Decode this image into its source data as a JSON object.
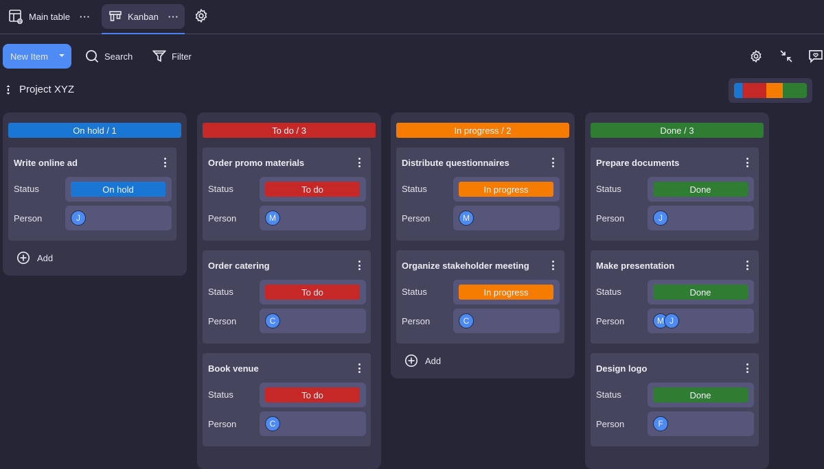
{
  "tabs": [
    {
      "label": "Main table",
      "icon": "table-icon",
      "menu": "···"
    },
    {
      "label": "Kanban",
      "icon": "kanban-icon",
      "menu": "···",
      "active": true
    }
  ],
  "toolbar": {
    "new_item_label": "New Item",
    "search_label": "Search",
    "filter_label": "Filter"
  },
  "project": {
    "title": "Project XYZ"
  },
  "colors": {
    "on_hold": "#1976d2",
    "to_do": "#c62828",
    "in_progress": "#f57c00",
    "done": "#2e7d32",
    "avatar": "#4d8af2",
    "accent": "#4f8bf5"
  },
  "summary": [
    {
      "status": "On hold",
      "count": 1,
      "color": "#1976d2"
    },
    {
      "status": "To do",
      "count": 3,
      "color": "#c62828"
    },
    {
      "status": "In progress",
      "count": 2,
      "color": "#f57c00"
    },
    {
      "status": "Done",
      "count": 3,
      "color": "#2e7d32"
    }
  ],
  "field_labels": {
    "status": "Status",
    "person": "Person"
  },
  "add_label": "Add",
  "columns": [
    {
      "header": "On hold / 1",
      "color": "#1976d2",
      "cards": [
        {
          "title": "Write online ad",
          "status": "On hold",
          "persons": [
            "J"
          ]
        }
      ]
    },
    {
      "header": "To do / 3",
      "color": "#c62828",
      "cards": [
        {
          "title": "Order promo materials",
          "status": "To do",
          "persons": [
            "M"
          ]
        },
        {
          "title": "Order catering",
          "status": "To do",
          "persons": [
            "C"
          ]
        },
        {
          "title": "Book venue",
          "status": "To do",
          "persons": [
            "C"
          ]
        }
      ]
    },
    {
      "header": "In progress / 2",
      "color": "#f57c00",
      "cards": [
        {
          "title": "Distribute questionnaires",
          "status": "In progress",
          "persons": [
            "M"
          ]
        },
        {
          "title": "Organize stakeholder meeting",
          "status": "In progress",
          "persons": [
            "C"
          ]
        }
      ]
    },
    {
      "header": "Done / 3",
      "color": "#2e7d32",
      "cards": [
        {
          "title": "Prepare documents",
          "status": "Done",
          "persons": [
            "J"
          ]
        },
        {
          "title": "Make presentation",
          "status": "Done",
          "persons": [
            "M",
            "J"
          ]
        },
        {
          "title": "Design logo",
          "status": "Done",
          "persons": [
            "F"
          ]
        }
      ]
    }
  ]
}
